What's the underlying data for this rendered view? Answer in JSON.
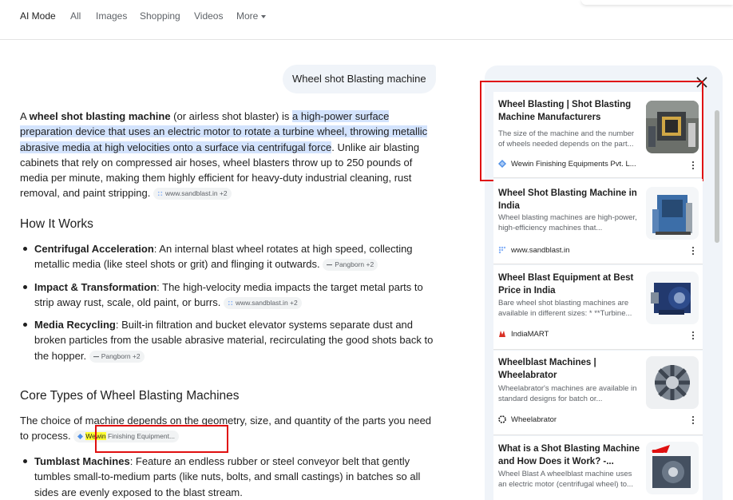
{
  "nav": {
    "tabs": [
      "AI Mode",
      "All",
      "Images",
      "Shopping",
      "Videos",
      "More"
    ]
  },
  "query": "Wheel shot Blasting machine",
  "intro": {
    "p1": "A ",
    "term": "wheel shot blasting machine",
    "p2": " (or airless shot blaster) is ",
    "highlight": "a high-power surface preparation device that uses an electric motor to rotate a turbine wheel, throwing metallic abrasive media at high velocities onto a surface via centrifugal force",
    "p3": ". Unlike air blasting cabinets that rely on compressed air hoses, wheel blasters throw up to 250 pounds of media per minute, making them highly efficient for heavy-duty industrial cleaning, rust removal, and paint stripping.",
    "chip": "www.sandblast.in +2"
  },
  "how": {
    "heading": "How It Works",
    "items": [
      {
        "term": "Centrifugal Acceleration",
        "text": ": An internal blast wheel rotates at high speed, collecting metallic media (like steel shots or grit) and flinging it outwards.",
        "chip": "Pangborn +2"
      },
      {
        "term": "Impact & Transformation",
        "text": ": The high-velocity media impacts the target metal parts to strip away rust, scale, old paint, or burrs.",
        "chip": "www.sandblast.in +2"
      },
      {
        "term": "Media Recycling",
        "text": ": Built-in filtration and bucket elevator systems separate dust and broken particles from the usable abrasive material, recirculating the good shots back to the hopper.",
        "chip": "Pangborn +2"
      }
    ]
  },
  "core": {
    "heading": "Core Types of Wheel Blasting Machines",
    "text": "The choice of machine depends on the geometry, size, and quantity of the parts you need to process.",
    "chip_mark": "Wewin",
    "chip_rest": " Finishing Equipment...",
    "items": [
      {
        "term": "Tumblast Machines",
        "text": ": Feature an endless rubber or steel conveyor belt that gently tumbles small-to-medium parts (like nuts, bolts, and small castings) in batches so all sides are evenly exposed to the blast stream."
      }
    ]
  },
  "sources": [
    {
      "title": "Wheel Blasting | Shot Blasting Machine Manufacturers",
      "snippet": "The size of the machine and the number of wheels needed depends on the part...",
      "site": "Wewin Finishing Equipments Pvt. L...",
      "icon": "wewin-logo-icon"
    },
    {
      "title": "Wheel Shot Blasting Machine in India",
      "snippet": "Wheel blasting machines are high-power, high-efficiency machines that...",
      "site": "www.sandblast.in",
      "icon": "sandblast-logo-icon"
    },
    {
      "title": "Wheel Blast Equipment at Best Price in India",
      "snippet": "Bare wheel shot blasting machines are available in different sizes: * **Turbine...",
      "site": "IndiaMART",
      "icon": "indiamart-logo-icon"
    },
    {
      "title": "Wheelblast Machines | Wheelabrator",
      "snippet": "Wheelabrator's machines are available in standard designs for batch or...",
      "site": "Wheelabrator",
      "icon": "wheelabrator-logo-icon"
    },
    {
      "title": "What is a Shot Blasting Machine and How Does it Work? -...",
      "snippet": "Wheel Blast A wheelblast machine uses an electric motor (centrifugal wheel) to...",
      "site": "",
      "icon": ""
    }
  ],
  "colors": {
    "highlight": "#d3e3fd",
    "annotation": "#e01010",
    "panel": "#f0f4f9",
    "mark": "#ffff33"
  }
}
